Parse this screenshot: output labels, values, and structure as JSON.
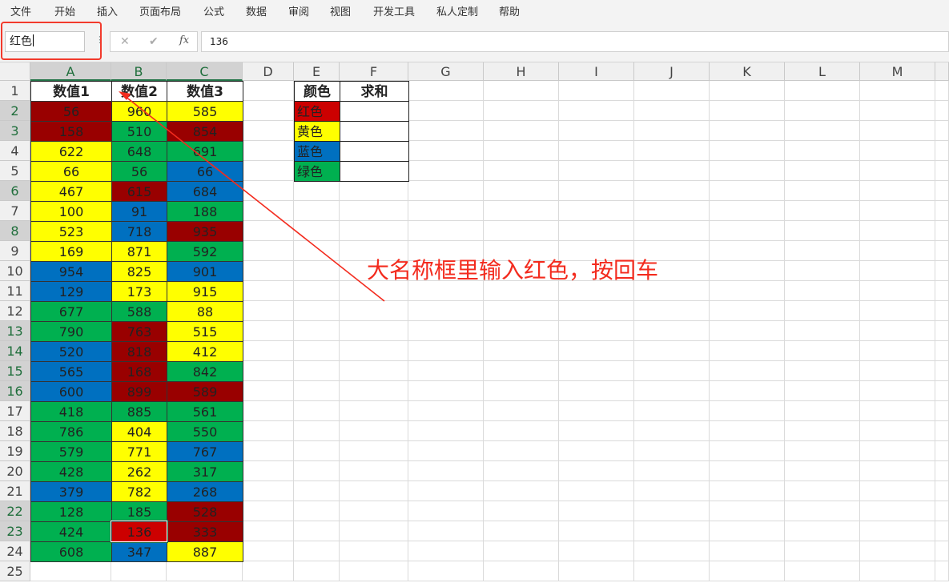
{
  "menu": [
    "文件",
    "开始",
    "插入",
    "页面布局",
    "公式",
    "数据",
    "审阅",
    "视图",
    "开发工具",
    "私人定制",
    "帮助"
  ],
  "formula_bar": {
    "name_box": "红色",
    "cancel_icon": "✕",
    "enter_icon": "✔",
    "fx_label": "fx",
    "formula": "136"
  },
  "columns": [
    "A",
    "B",
    "C",
    "D",
    "E",
    "F",
    "G",
    "H",
    "I",
    "J",
    "K",
    "L",
    "M"
  ],
  "headers": [
    "数值1",
    "数值2",
    "数值3"
  ],
  "rows": [
    [
      {
        "v": "56",
        "c": "dred"
      },
      {
        "v": "960",
        "c": "yellow"
      },
      {
        "v": "585",
        "c": "yellow"
      }
    ],
    [
      {
        "v": "158",
        "c": "dred"
      },
      {
        "v": "510",
        "c": "green"
      },
      {
        "v": "854",
        "c": "dred"
      }
    ],
    [
      {
        "v": "622",
        "c": "yellow"
      },
      {
        "v": "648",
        "c": "green"
      },
      {
        "v": "691",
        "c": "green"
      }
    ],
    [
      {
        "v": "66",
        "c": "yellow"
      },
      {
        "v": "56",
        "c": "green"
      },
      {
        "v": "66",
        "c": "blue"
      }
    ],
    [
      {
        "v": "467",
        "c": "yellow"
      },
      {
        "v": "615",
        "c": "dred"
      },
      {
        "v": "684",
        "c": "blue"
      }
    ],
    [
      {
        "v": "100",
        "c": "yellow"
      },
      {
        "v": "91",
        "c": "blue"
      },
      {
        "v": "188",
        "c": "green"
      }
    ],
    [
      {
        "v": "523",
        "c": "yellow"
      },
      {
        "v": "718",
        "c": "blue"
      },
      {
        "v": "935",
        "c": "dred"
      }
    ],
    [
      {
        "v": "169",
        "c": "yellow"
      },
      {
        "v": "871",
        "c": "yellow"
      },
      {
        "v": "592",
        "c": "green"
      }
    ],
    [
      {
        "v": "954",
        "c": "blue"
      },
      {
        "v": "825",
        "c": "yellow"
      },
      {
        "v": "901",
        "c": "blue"
      }
    ],
    [
      {
        "v": "129",
        "c": "blue"
      },
      {
        "v": "173",
        "c": "yellow"
      },
      {
        "v": "915",
        "c": "yellow"
      }
    ],
    [
      {
        "v": "677",
        "c": "green"
      },
      {
        "v": "588",
        "c": "green"
      },
      {
        "v": "88",
        "c": "yellow"
      }
    ],
    [
      {
        "v": "790",
        "c": "green"
      },
      {
        "v": "763",
        "c": "dred"
      },
      {
        "v": "515",
        "c": "yellow"
      }
    ],
    [
      {
        "v": "520",
        "c": "blue"
      },
      {
        "v": "818",
        "c": "dred"
      },
      {
        "v": "412",
        "c": "yellow"
      }
    ],
    [
      {
        "v": "565",
        "c": "blue"
      },
      {
        "v": "168",
        "c": "dred"
      },
      {
        "v": "842",
        "c": "green"
      }
    ],
    [
      {
        "v": "600",
        "c": "blue"
      },
      {
        "v": "899",
        "c": "dred"
      },
      {
        "v": "589",
        "c": "dred"
      }
    ],
    [
      {
        "v": "418",
        "c": "green"
      },
      {
        "v": "885",
        "c": "green"
      },
      {
        "v": "561",
        "c": "green"
      }
    ],
    [
      {
        "v": "786",
        "c": "green"
      },
      {
        "v": "404",
        "c": "yellow"
      },
      {
        "v": "550",
        "c": "green"
      }
    ],
    [
      {
        "v": "579",
        "c": "green"
      },
      {
        "v": "771",
        "c": "yellow"
      },
      {
        "v": "767",
        "c": "blue"
      }
    ],
    [
      {
        "v": "428",
        "c": "green"
      },
      {
        "v": "262",
        "c": "yellow"
      },
      {
        "v": "317",
        "c": "green"
      }
    ],
    [
      {
        "v": "379",
        "c": "blue"
      },
      {
        "v": "782",
        "c": "yellow"
      },
      {
        "v": "268",
        "c": "blue"
      }
    ],
    [
      {
        "v": "128",
        "c": "green"
      },
      {
        "v": "185",
        "c": "green"
      },
      {
        "v": "528",
        "c": "dred"
      }
    ],
    [
      {
        "v": "424",
        "c": "green"
      },
      {
        "v": "136",
        "c": "red"
      },
      {
        "v": "333",
        "c": "dred"
      }
    ],
    [
      {
        "v": "608",
        "c": "green"
      },
      {
        "v": "347",
        "c": "blue"
      },
      {
        "v": "887",
        "c": "yellow"
      }
    ]
  ],
  "summary": {
    "headers": [
      "颜色",
      "求和"
    ],
    "items": [
      {
        "label": "红色",
        "c": "red",
        "sum": ""
      },
      {
        "label": "黄色",
        "c": "yellow",
        "sum": ""
      },
      {
        "label": "蓝色",
        "c": "blue",
        "sum": ""
      },
      {
        "label": "绿色",
        "c": "green",
        "sum": ""
      }
    ]
  },
  "annotation": "大名称框里输入红色，按回车",
  "colors": {
    "dred": "#990000",
    "red": "#cc0000",
    "yellow": "#ffff00",
    "green": "#00b050",
    "blue": "#0070c0",
    "annotation": "#f32b1e"
  }
}
